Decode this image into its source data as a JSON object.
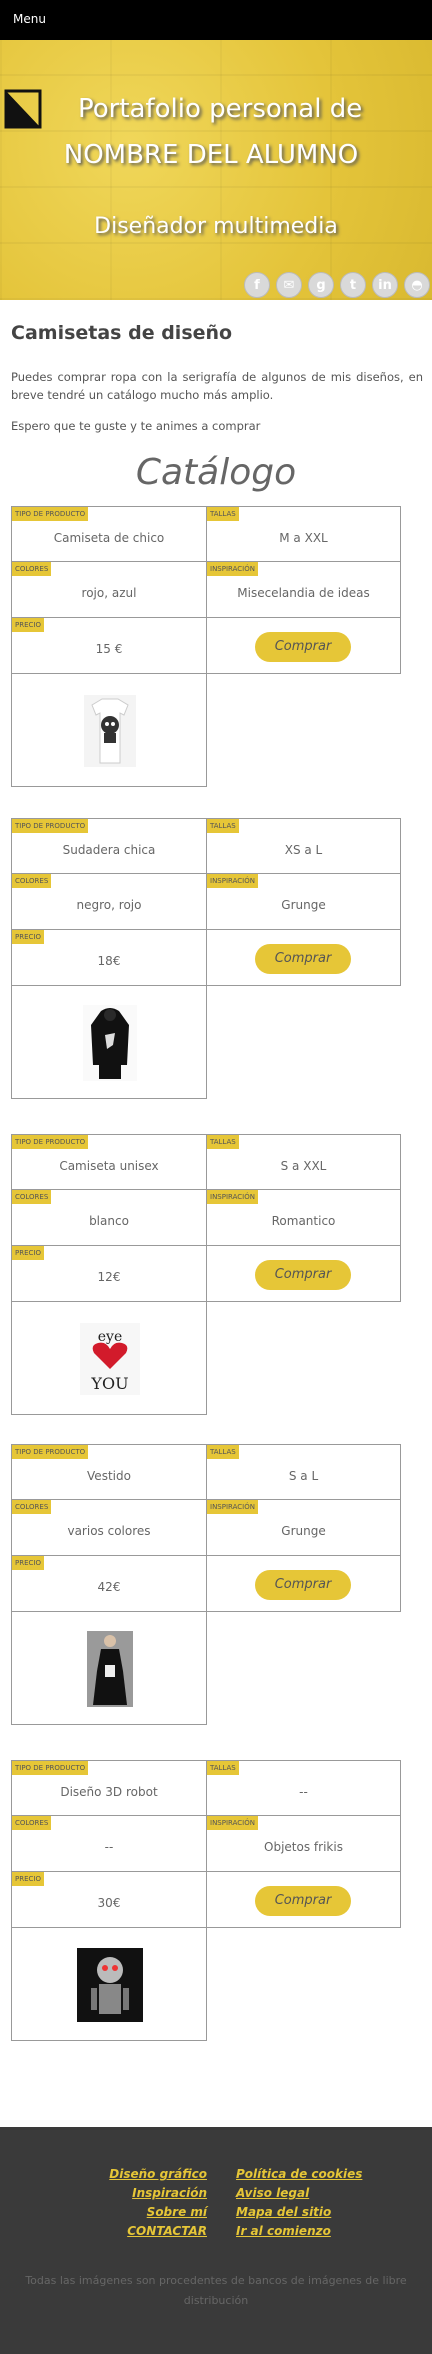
{
  "nav": {
    "menu_label": "Menu"
  },
  "hero": {
    "title_line1": "Portafolio personal de",
    "title_line2": "NOMBRE DEL ALUMNO",
    "subtitle": "Diseñador multimedia",
    "social_icons": [
      "facebook-icon",
      "email-icon",
      "google-plus-icon",
      "twitter-icon",
      "linkedin-icon",
      "github-icon"
    ]
  },
  "intro": {
    "title": "Camisetas de diseño",
    "paragraph1": "Puedes comprar ropa con la serigrafía de algunos de mis diseños, en breve tendré un catálogo mucho más amplio.",
    "paragraph2": "Espero que te guste y te animes a comprar"
  },
  "catalog": {
    "title": "Catálogo",
    "labels": {
      "type": "TIPO DE PRODUCTO",
      "sizes": "TALLAS",
      "colors": "COLORES",
      "inspiration": "INSPIRACIÓN",
      "price": "PRECIO"
    },
    "buy_label": "Comprar",
    "products": [
      {
        "type": "Camiseta de chico",
        "sizes": "M a XXL",
        "colors": "rojo, azul",
        "inspiration": "Misecelandia de ideas",
        "price": "15 €",
        "image": "tshirt-skull"
      },
      {
        "type": "Sudadera chica",
        "sizes": "XS a L",
        "colors": "negro, rojo",
        "inspiration": "Grunge",
        "price": "18€",
        "image": "black-hoodie"
      },
      {
        "type": "Camiseta unisex",
        "sizes": "S a XXL",
        "colors": "blanco",
        "inspiration": "Romantico",
        "price": "12€",
        "image": "eye-heart-you"
      },
      {
        "type": "Vestido",
        "sizes": "S a L",
        "colors": "varios colores",
        "inspiration": "Grunge",
        "price": "42€",
        "image": "black-dress"
      },
      {
        "type": "Diseño 3D robot",
        "sizes": "--",
        "colors": "--",
        "inspiration": "Objetos frikis",
        "price": "30€",
        "image": "robot-3d"
      }
    ]
  },
  "footer": {
    "left_links": [
      "Diseño gráfico",
      "Inspiración",
      "Sobre mí",
      "CONTACTAR"
    ],
    "right_links": [
      "Política de cookies",
      "Aviso legal",
      "Mapa del sitio",
      "Ir al comienzo"
    ],
    "note": "Todas las imágenes son procedentes de bancos de imágenes de libre distribución"
  },
  "colors": {
    "accent": "#e6c637",
    "topbar": "#000000",
    "footer_bg": "#3a3a3a"
  }
}
